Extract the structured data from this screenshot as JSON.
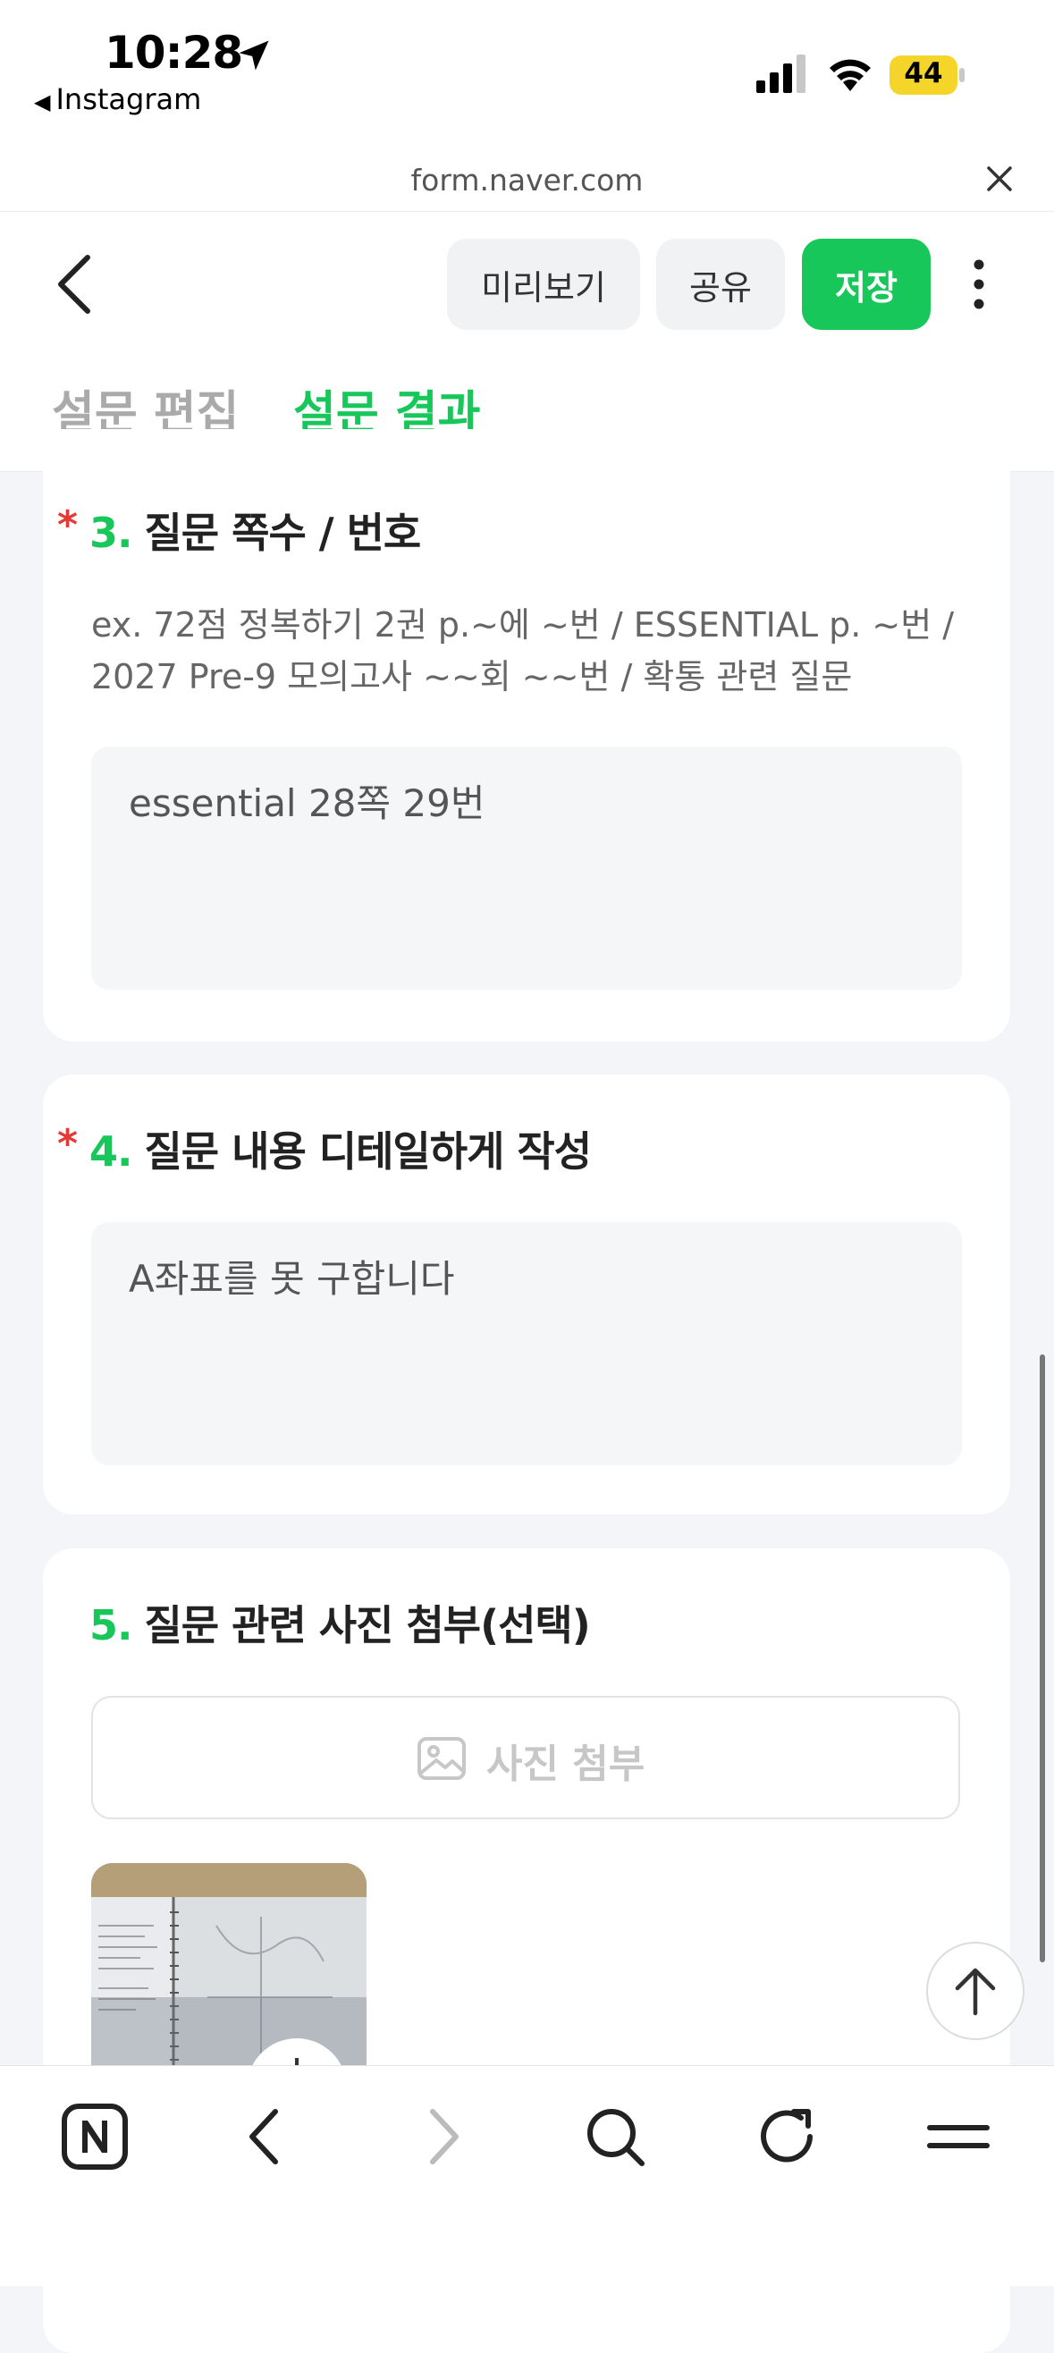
{
  "status_bar": {
    "time": "10:28",
    "back_app": "Instagram",
    "battery": "44",
    "icons": [
      "location-arrow-icon",
      "signal-icon",
      "wifi-icon",
      "battery-icon"
    ]
  },
  "browser": {
    "url": "form.naver.com"
  },
  "header": {
    "preview_label": "미리보기",
    "share_label": "공유",
    "save_label": "저장",
    "tabs": [
      {
        "label": "설문 편집",
        "active": false
      },
      {
        "label": "설문 결과",
        "active": true
      }
    ]
  },
  "questions": [
    {
      "number": "3.",
      "title": "질문 쪽수 / 번호",
      "required": "*",
      "description": [
        "ex. 72점 정복하기 2권 p.~에 ~번 / ESSENTIAL p. ~번 /",
        "2027 Pre-9 모의고사 ~~회 ~~번  / 확통 관련 질문"
      ],
      "answer": "essential 28쪽 29번"
    },
    {
      "number": "4.",
      "title": "질문 내용 디테일하게 작성",
      "required": "*",
      "answer": "A좌표를 못 구합니다"
    },
    {
      "number": "5.",
      "title": "질문 관련 사진 첨부(선택)",
      "attach_label": "사진 첨부"
    }
  ],
  "colors": {
    "accent": "#17c75a",
    "required": "#e53935",
    "background": "#f4f5f8"
  }
}
